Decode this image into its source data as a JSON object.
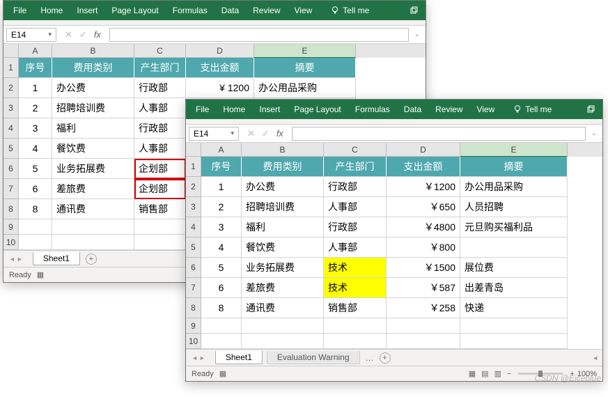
{
  "ribbon": {
    "tabs": [
      "File",
      "Home",
      "Insert",
      "Page Layout",
      "Formulas",
      "Data",
      "Review",
      "View"
    ],
    "tell_me": "Tell me"
  },
  "namebox": {
    "value": "E14"
  },
  "fx": {
    "cancel": "✕",
    "confirm": "✓",
    "fx": "fx"
  },
  "columns": [
    "A",
    "B",
    "C",
    "D",
    "E"
  ],
  "headers": [
    "序号",
    "费用类别",
    "产生部门",
    "支出金额",
    "摘要"
  ],
  "w1_rows": [
    {
      "n": "1",
      "cat": "办公费",
      "dept": "行政部",
      "amt": "",
      "note": ""
    },
    {
      "n": "2",
      "cat": "招聘培训费",
      "dept": "人事部",
      "amt": "",
      "note": ""
    },
    {
      "n": "3",
      "cat": "福利",
      "dept": "行政部",
      "amt": "",
      "note": ""
    },
    {
      "n": "4",
      "cat": "餐饮费",
      "dept": "人事部",
      "amt": "",
      "note": ""
    },
    {
      "n": "5",
      "cat": "业务拓展费",
      "dept": "企划部",
      "amt": "",
      "note": ""
    },
    {
      "n": "6",
      "cat": "差旅费",
      "dept": "企划部",
      "amt": "",
      "note": ""
    },
    {
      "n": "8",
      "cat": "通讯费",
      "dept": "销售部",
      "amt": "",
      "note": ""
    }
  ],
  "w1_amt_partial": "¥ 1200",
  "w1_note_partial": "办公用品采购",
  "w2_rows": [
    {
      "n": "1",
      "cat": "办公费",
      "dept": "行政部",
      "amt": "￥1200",
      "note": "办公用品采购",
      "hl": false
    },
    {
      "n": "2",
      "cat": "招聘培训费",
      "dept": "人事部",
      "amt": "￥650",
      "note": "人员招聘",
      "hl": false
    },
    {
      "n": "3",
      "cat": "福利",
      "dept": "行政部",
      "amt": "￥4800",
      "note": "元旦购买福利品",
      "hl": false
    },
    {
      "n": "4",
      "cat": "餐饮费",
      "dept": "人事部",
      "amt": "￥800",
      "note": "",
      "hl": false
    },
    {
      "n": "5",
      "cat": "业务拓展费",
      "dept": "技术",
      "amt": "￥1500",
      "note": "展位费",
      "hl": true
    },
    {
      "n": "6",
      "cat": "差旅费",
      "dept": "技术",
      "amt": "￥587",
      "note": "出差青岛",
      "hl": true
    },
    {
      "n": "8",
      "cat": "通讯费",
      "dept": "销售部",
      "amt": "￥258",
      "note": "快递",
      "hl": false
    }
  ],
  "sheet_tabs": {
    "sheet1": "Sheet1",
    "eval_warn": "Evaluation Warning"
  },
  "status": {
    "ready": "Ready",
    "zoom": "100%"
  },
  "icons": {
    "bulb": "bulb-icon",
    "window": "window-icon",
    "chevron_left": "◄",
    "chevron_right": "►",
    "macro": "⊞"
  },
  "watermark": "CSDN @Eiceblue"
}
